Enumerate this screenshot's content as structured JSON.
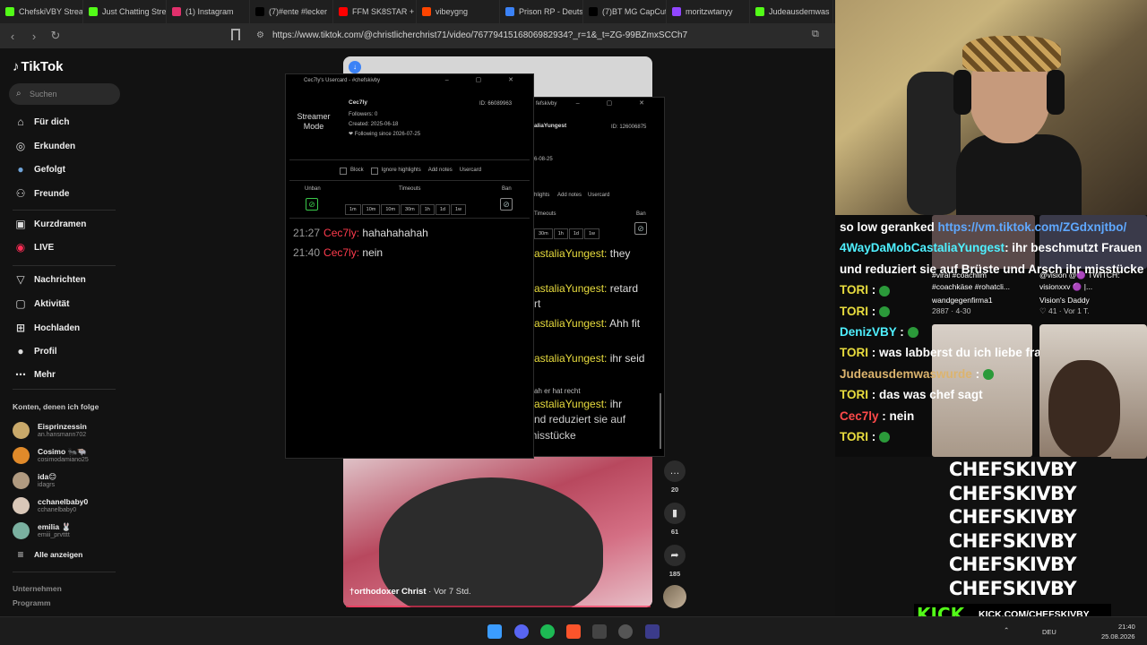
{
  "browser": {
    "tabs": [
      {
        "label": "ChefskiVBY Strea",
        "color": "#53fc18"
      },
      {
        "label": "Just Chatting Stre",
        "color": "#53fc18"
      },
      {
        "label": "(1) Instagram",
        "color": "#e1306c"
      },
      {
        "label": "(7)#ente #lecker",
        "color": "#000000"
      },
      {
        "label": "FFM SK8STAR +",
        "color": "#ff0000"
      },
      {
        "label": "vibeygng",
        "color": "#ff4500"
      },
      {
        "label": "Prison RP - Deutsc",
        "color": "#3b82f6"
      },
      {
        "label": "(7)BT MG CapCut",
        "color": "#000000"
      },
      {
        "label": "moritzwtanyy",
        "color": "#9146ff"
      },
      {
        "label": "Judeausdemwas",
        "color": "#53fc18"
      }
    ],
    "url": "https://www.tiktok.com/@christlicherchrist71/video/7677941516806982934?_r=1&_t=ZG-99BZmxSCCh7"
  },
  "tiktok": {
    "logo": "TikTok",
    "search_placeholder": "Suchen",
    "nav": [
      {
        "label": "Für dich",
        "icon": "home-icon"
      },
      {
        "label": "Erkunden",
        "icon": "compass-icon"
      },
      {
        "label": "Gefolgt",
        "icon": "following-icon"
      },
      {
        "label": "Freunde",
        "icon": "friends-icon"
      },
      {
        "label": "Kurzdramen",
        "icon": "film-icon"
      },
      {
        "label": "LIVE",
        "icon": "live-icon"
      },
      {
        "label": "Nachrichten",
        "icon": "messages-icon"
      },
      {
        "label": "Aktivität",
        "icon": "activity-icon"
      },
      {
        "label": "Hochladen",
        "icon": "upload-icon"
      },
      {
        "label": "Profil",
        "icon": "profile-icon"
      },
      {
        "label": "Mehr",
        "icon": "more-icon"
      }
    ],
    "following_title": "Konten, denen ich folge",
    "accounts": [
      {
        "name": "Eisprinzessin",
        "handle": "an.hansmann702",
        "color": "#c9a96a"
      },
      {
        "name": "Cosimo 🐜🐃",
        "handle": "cosimodamiano25",
        "color": "#e08a2a"
      },
      {
        "name": "ida😊",
        "handle": "idagrs",
        "color": "#b09a80"
      },
      {
        "name": "cchanelbaby0",
        "handle": "cchanelbaby0",
        "color": "#d9c7b8"
      },
      {
        "name": "emilia 🐰",
        "handle": "emiii_prvtttt",
        "color": "#7ab0a0"
      }
    ],
    "see_all": "Alle anzeigen",
    "footer": [
      "Unternehmen",
      "Programm"
    ],
    "video": {
      "author": "†orthodoxer Christ",
      "ago": "· Vor 7 Std.",
      "comments": "20",
      "saves": "61",
      "shares": "185"
    }
  },
  "usercard1": {
    "title": "Cec7ly's Usercard - #chefskivby",
    "streamer_mode": "Streamer Mode",
    "user": "Cec7ly",
    "id": "ID: 66089963",
    "followers": "Followers: 0",
    "created": "Created: 2025-06-18",
    "following": "❤ Following since 2026-07-25",
    "block": "Block",
    "ignore": "Ignore highlights",
    "add_notes": "Add notes",
    "usercard": "Usercard",
    "unban": "Unban",
    "timeouts": "Timeouts",
    "ban": "Ban",
    "durations": [
      "1m",
      "10m",
      "10m",
      "30m",
      "1h",
      "1d",
      "1w"
    ],
    "messages": [
      {
        "time": "21:27",
        "user": "Cec7ly:",
        "text": "hahahahahah"
      },
      {
        "time": "21:40",
        "user": "Cec7ly:",
        "text": "nein"
      }
    ]
  },
  "usercard2": {
    "title": "fefskivby",
    "user": "aliaYungest",
    "id": "ID: 126006875",
    "date": "6-08-25",
    "hlights": "hlights",
    "add_notes": "Add notes",
    "usercard": "Usercard",
    "timeouts": "Timeouts",
    "ban": "Ban",
    "durations": [
      "30m",
      "1h",
      "1d",
      "1w"
    ],
    "messages": [
      {
        "user": "astaliaYungest:",
        "text": "they"
      },
      {
        "user": "astaliaYungest:",
        "text": "retard",
        "extra": "rt"
      },
      {
        "user": "astaliaYungest:",
        "text": "Ahh fit"
      },
      {
        "user": "astaliaYungest:",
        "text": "ihr seid"
      }
    ],
    "quote": "ah er hat recht",
    "last_user": "astaliaYungest:",
    "last_text": "ihr",
    "last_cont": "nd reduziert sie auf",
    "last_cont2": "Brüste und Arsch ihr misstücke"
  },
  "overlay_chat": {
    "lines": [
      {
        "name": "",
        "text": "so low geranked ",
        "link": "https://vm.tiktok.com/ZGdxnjtbo/"
      },
      {
        "name": "4WayDaMobCastaliaYungest",
        "text": ": ihr beschmutzt Frauen"
      },
      {
        "name": "",
        "text": "und reduziert sie auf Brüste und Arsch ihr misstücke"
      },
      {
        "name": "TORI",
        "text": " : "
      },
      {
        "name": "TORI",
        "text": " : "
      },
      {
        "name": "DenizVBY",
        "text": " : "
      },
      {
        "name": "TORI",
        "text": " : was labberst du ich liebe frauen"
      },
      {
        "name": "Judeausdemwaswurde",
        "text": " : "
      },
      {
        "name": "TORI",
        "text": " : das was chef sagt"
      },
      {
        "name": "Cec7ly",
        "text": " : nein"
      },
      {
        "name": "TORI",
        "text": " : "
      }
    ]
  },
  "thumbs": {
    "caps": [
      "#viral #coachlim",
      "#coachkäse #rohatcli...",
      "wandgegenfirma1",
      "2887 · 4-30",
      "@vision @🟣 TWITCH:",
      "visionxxv 🟣 |...",
      "Vision's Daddy",
      "♡ 41 · Vor 1 T."
    ]
  },
  "promo": {
    "lines": [
      "CHEFSKIVBY",
      "CHEFSKIVBY",
      "CHEFSKIVBY",
      "CHEFSKIVBY",
      "CHEFSKIVBY",
      "CHEFSKIVBY"
    ],
    "kick": "KICK",
    "kick_url": "KICK.COM/CHEFSKIVBY"
  },
  "taskbar": {
    "lang": "DEU",
    "time": "21:40",
    "date": "25.08.2026"
  }
}
